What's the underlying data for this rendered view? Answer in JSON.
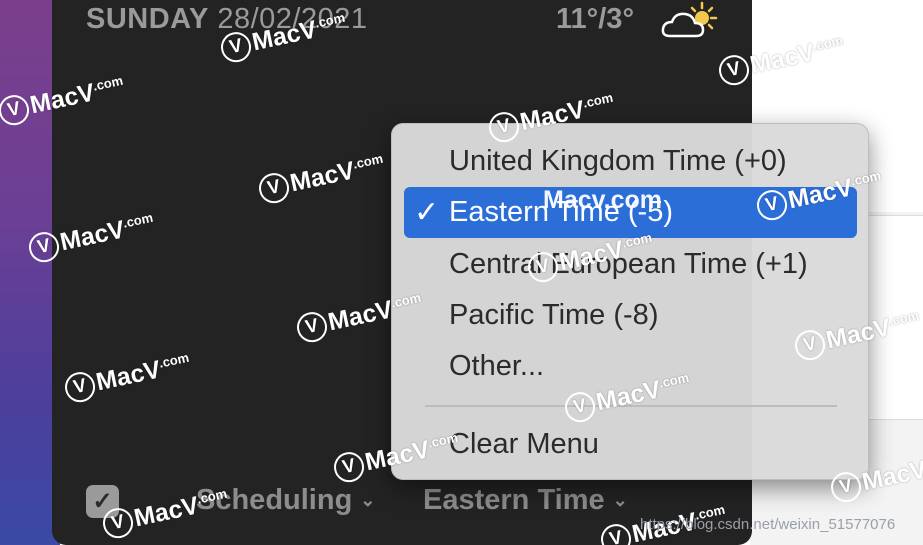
{
  "widget": {
    "day": "SUNDAY",
    "date": "28/02/2021",
    "temperature": "11°/3°",
    "weather_icon": "partly-cloudy-icon"
  },
  "timezone_menu": {
    "items": [
      {
        "label": "United Kingdom Time (+0)",
        "selected": false
      },
      {
        "label": "Eastern Time (-5)",
        "selected": true
      },
      {
        "label": "Central European Time (+1)",
        "selected": false
      },
      {
        "label": "Pacific Time (-8)",
        "selected": false
      },
      {
        "label": "Other...",
        "selected": false
      }
    ],
    "clear_label": "Clear Menu",
    "check_glyph": "✓"
  },
  "bottom_bar": {
    "checkbox_checked": true,
    "checkbox_glyph": "✓",
    "scheduling_label": "Scheduling",
    "timezone_label": "Eastern Time",
    "chevron_glyph": "⌄"
  },
  "watermark": {
    "brand": "MacV",
    "domain": ".com",
    "logo_glyph": "V",
    "overlay": "Macv.com",
    "url": "https://blog.csdn.net/weixin_51577076"
  },
  "colors": {
    "panel": "#232323",
    "accent": "#2c6ed8",
    "menu_bg": "#dadada"
  }
}
